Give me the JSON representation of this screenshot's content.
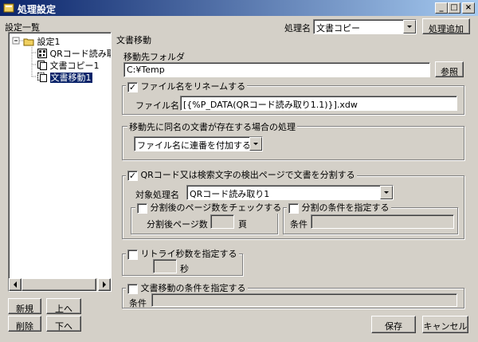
{
  "window": {
    "title": "処理設定",
    "buttons": [
      "_",
      "□",
      "×"
    ]
  },
  "left": {
    "section_label": "設定一覧",
    "tree": [
      {
        "label": "設定1"
      },
      {
        "label": "QRコード読み取"
      },
      {
        "label": "文書コピー1"
      },
      {
        "label": "文書移動1"
      }
    ],
    "buttons": {
      "new": "新規",
      "up": "上へ",
      "delete": "削除",
      "down": "下へ"
    }
  },
  "header": {
    "process_name_label": "処理名",
    "process_name_value": "文書コピー",
    "add_process_button": "処理追加"
  },
  "main": {
    "section_title": "文書移動",
    "dest_folder": {
      "label": "移動先フォルダ",
      "value": "C:¥Temp",
      "browse_button": "参照"
    },
    "rename": {
      "checkbox_label": "ファイル名をリネームする",
      "checked": true,
      "file_name_label": "ファイル名",
      "file_name_value": "[{%P_DATA(QRコード読み取り1.1)}].xdw"
    },
    "duplicate": {
      "group_label": "移動先に同名の文書が存在する場合の処理",
      "value": "ファイル名に連番を付加する"
    },
    "split": {
      "checkbox_label": "QRコード又は検索文字の検出ページで文書を分割する",
      "checked": true,
      "target_label": "対象処理名",
      "target_value": "QRコード読み取り1",
      "page_check": {
        "checkbox_label": "分割後のページ数をチェックする",
        "checked": false,
        "pages_label": "分割後ページ数",
        "pages_value": "",
        "unit": "頁"
      },
      "condition": {
        "checkbox_label": "分割の条件を指定する",
        "checked": false,
        "label": "条件",
        "value": ""
      }
    },
    "retry": {
      "checkbox_label": "リトライ秒数を指定する",
      "checked": false,
      "value": "",
      "unit": "秒"
    },
    "move_condition": {
      "checkbox_label": "文書移動の条件を指定する",
      "checked": false,
      "label": "条件",
      "value": ""
    }
  },
  "footer": {
    "save_button": "保存",
    "cancel_button": "キャンセル"
  }
}
